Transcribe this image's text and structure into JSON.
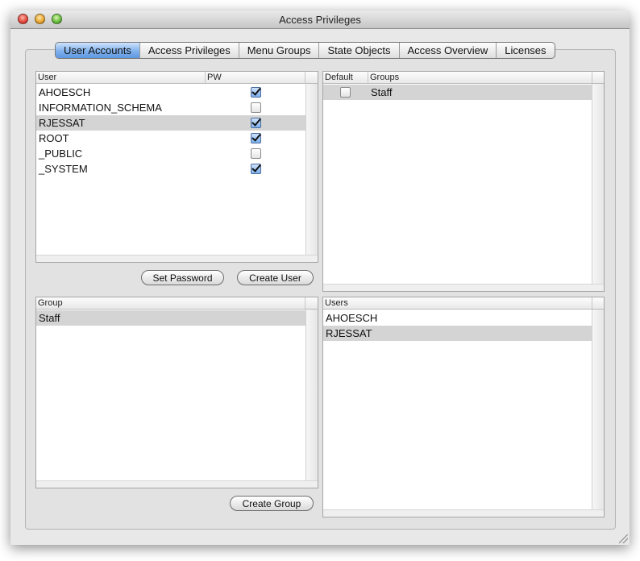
{
  "window": {
    "title": "Access Privileges"
  },
  "tabs": [
    {
      "label": "User Accounts",
      "active": true
    },
    {
      "label": "Access Privileges",
      "active": false
    },
    {
      "label": "Menu Groups",
      "active": false
    },
    {
      "label": "State Objects",
      "active": false
    },
    {
      "label": "Access Overview",
      "active": false
    },
    {
      "label": "Licenses",
      "active": false
    }
  ],
  "user_table": {
    "columns": [
      "User",
      "PW"
    ],
    "rows": [
      {
        "user": "AHOESCH",
        "pw": true,
        "selected": false
      },
      {
        "user": "INFORMATION_SCHEMA",
        "pw": false,
        "selected": false
      },
      {
        "user": "RJESSAT",
        "pw": true,
        "selected": true
      },
      {
        "user": "ROOT",
        "pw": true,
        "selected": false
      },
      {
        "user": "_PUBLIC",
        "pw": false,
        "selected": false
      },
      {
        "user": "_SYSTEM",
        "pw": true,
        "selected": false
      }
    ]
  },
  "user_groups_table": {
    "columns": [
      "Default",
      "Groups"
    ],
    "rows": [
      {
        "default": false,
        "group": "Staff",
        "selected": true
      }
    ]
  },
  "buttons": {
    "set_password": "Set Password",
    "create_user": "Create User",
    "create_group": "Create Group"
  },
  "group_table": {
    "columns": [
      "Group"
    ],
    "rows": [
      {
        "group": "Staff",
        "selected": true
      }
    ]
  },
  "group_users_table": {
    "columns": [
      "Users"
    ],
    "rows": [
      {
        "user": "AHOESCH",
        "selected": false
      },
      {
        "user": "RJESSAT",
        "selected": true
      }
    ]
  },
  "colors": {
    "tab_active": "#7fb1ec",
    "selection": "#d4d4d4",
    "checkbox_on": "#7cb0ee"
  }
}
